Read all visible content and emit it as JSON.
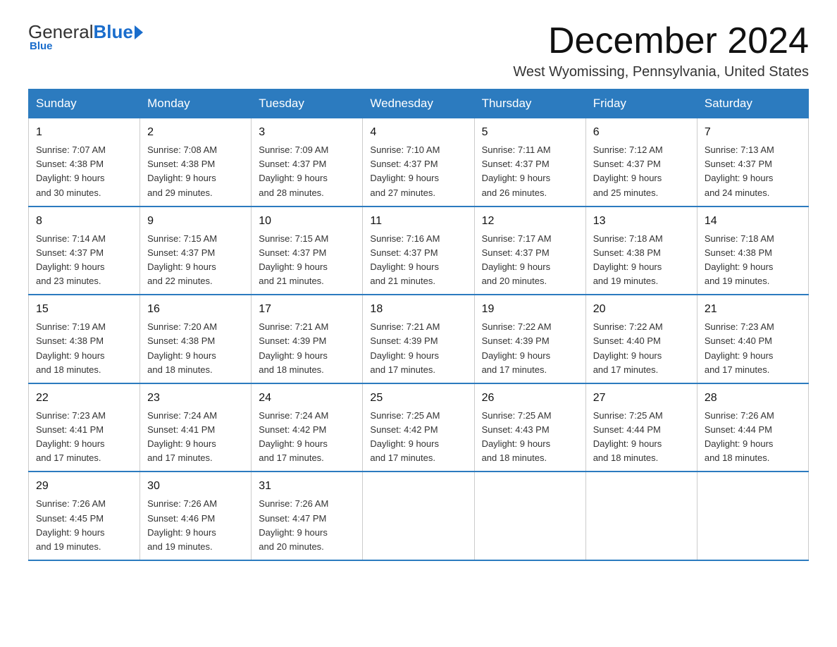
{
  "header": {
    "logo_general": "General",
    "logo_blue": "Blue",
    "month_title": "December 2024",
    "location": "West Wyomissing, Pennsylvania, United States"
  },
  "days_of_week": [
    "Sunday",
    "Monday",
    "Tuesday",
    "Wednesday",
    "Thursday",
    "Friday",
    "Saturday"
  ],
  "weeks": [
    [
      {
        "day": "1",
        "sunrise": "7:07 AM",
        "sunset": "4:38 PM",
        "daylight": "9 hours and 30 minutes."
      },
      {
        "day": "2",
        "sunrise": "7:08 AM",
        "sunset": "4:38 PM",
        "daylight": "9 hours and 29 minutes."
      },
      {
        "day": "3",
        "sunrise": "7:09 AM",
        "sunset": "4:37 PM",
        "daylight": "9 hours and 28 minutes."
      },
      {
        "day": "4",
        "sunrise": "7:10 AM",
        "sunset": "4:37 PM",
        "daylight": "9 hours and 27 minutes."
      },
      {
        "day": "5",
        "sunrise": "7:11 AM",
        "sunset": "4:37 PM",
        "daylight": "9 hours and 26 minutes."
      },
      {
        "day": "6",
        "sunrise": "7:12 AM",
        "sunset": "4:37 PM",
        "daylight": "9 hours and 25 minutes."
      },
      {
        "day": "7",
        "sunrise": "7:13 AM",
        "sunset": "4:37 PM",
        "daylight": "9 hours and 24 minutes."
      }
    ],
    [
      {
        "day": "8",
        "sunrise": "7:14 AM",
        "sunset": "4:37 PM",
        "daylight": "9 hours and 23 minutes."
      },
      {
        "day": "9",
        "sunrise": "7:15 AM",
        "sunset": "4:37 PM",
        "daylight": "9 hours and 22 minutes."
      },
      {
        "day": "10",
        "sunrise": "7:15 AM",
        "sunset": "4:37 PM",
        "daylight": "9 hours and 21 minutes."
      },
      {
        "day": "11",
        "sunrise": "7:16 AM",
        "sunset": "4:37 PM",
        "daylight": "9 hours and 21 minutes."
      },
      {
        "day": "12",
        "sunrise": "7:17 AM",
        "sunset": "4:37 PM",
        "daylight": "9 hours and 20 minutes."
      },
      {
        "day": "13",
        "sunrise": "7:18 AM",
        "sunset": "4:38 PM",
        "daylight": "9 hours and 19 minutes."
      },
      {
        "day": "14",
        "sunrise": "7:18 AM",
        "sunset": "4:38 PM",
        "daylight": "9 hours and 19 minutes."
      }
    ],
    [
      {
        "day": "15",
        "sunrise": "7:19 AM",
        "sunset": "4:38 PM",
        "daylight": "9 hours and 18 minutes."
      },
      {
        "day": "16",
        "sunrise": "7:20 AM",
        "sunset": "4:38 PM",
        "daylight": "9 hours and 18 minutes."
      },
      {
        "day": "17",
        "sunrise": "7:21 AM",
        "sunset": "4:39 PM",
        "daylight": "9 hours and 18 minutes."
      },
      {
        "day": "18",
        "sunrise": "7:21 AM",
        "sunset": "4:39 PM",
        "daylight": "9 hours and 17 minutes."
      },
      {
        "day": "19",
        "sunrise": "7:22 AM",
        "sunset": "4:39 PM",
        "daylight": "9 hours and 17 minutes."
      },
      {
        "day": "20",
        "sunrise": "7:22 AM",
        "sunset": "4:40 PM",
        "daylight": "9 hours and 17 minutes."
      },
      {
        "day": "21",
        "sunrise": "7:23 AM",
        "sunset": "4:40 PM",
        "daylight": "9 hours and 17 minutes."
      }
    ],
    [
      {
        "day": "22",
        "sunrise": "7:23 AM",
        "sunset": "4:41 PM",
        "daylight": "9 hours and 17 minutes."
      },
      {
        "day": "23",
        "sunrise": "7:24 AM",
        "sunset": "4:41 PM",
        "daylight": "9 hours and 17 minutes."
      },
      {
        "day": "24",
        "sunrise": "7:24 AM",
        "sunset": "4:42 PM",
        "daylight": "9 hours and 17 minutes."
      },
      {
        "day": "25",
        "sunrise": "7:25 AM",
        "sunset": "4:42 PM",
        "daylight": "9 hours and 17 minutes."
      },
      {
        "day": "26",
        "sunrise": "7:25 AM",
        "sunset": "4:43 PM",
        "daylight": "9 hours and 18 minutes."
      },
      {
        "day": "27",
        "sunrise": "7:25 AM",
        "sunset": "4:44 PM",
        "daylight": "9 hours and 18 minutes."
      },
      {
        "day": "28",
        "sunrise": "7:26 AM",
        "sunset": "4:44 PM",
        "daylight": "9 hours and 18 minutes."
      }
    ],
    [
      {
        "day": "29",
        "sunrise": "7:26 AM",
        "sunset": "4:45 PM",
        "daylight": "9 hours and 19 minutes."
      },
      {
        "day": "30",
        "sunrise": "7:26 AM",
        "sunset": "4:46 PM",
        "daylight": "9 hours and 19 minutes."
      },
      {
        "day": "31",
        "sunrise": "7:26 AM",
        "sunset": "4:47 PM",
        "daylight": "9 hours and 20 minutes."
      },
      null,
      null,
      null,
      null
    ]
  ],
  "labels": {
    "sunrise_prefix": "Sunrise: ",
    "sunset_prefix": "Sunset: ",
    "daylight_prefix": "Daylight: "
  }
}
